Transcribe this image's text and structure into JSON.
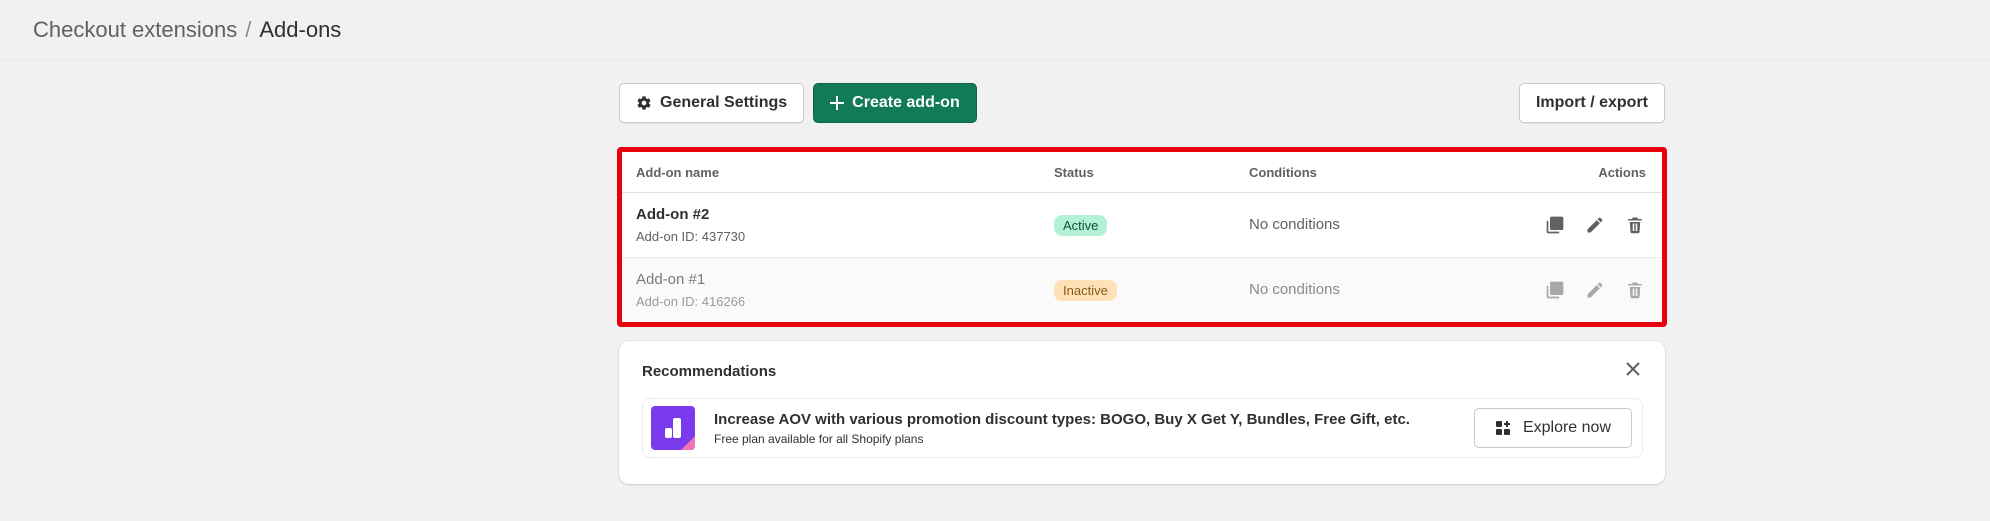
{
  "breadcrumb": {
    "parent": "Checkout extensions",
    "separator": "/",
    "current": "Add-ons"
  },
  "toolbar": {
    "general_settings_label": "General Settings",
    "create_label": "Create add-on",
    "import_export_label": "Import / export"
  },
  "table": {
    "headers": {
      "name": "Add-on name",
      "status": "Status",
      "conditions": "Conditions",
      "actions": "Actions"
    },
    "rows": [
      {
        "name": "Add-on #2",
        "id_text": "Add-on ID: 437730",
        "status": "Active",
        "conditions": "No conditions"
      },
      {
        "name": "Add-on #1",
        "id_text": "Add-on ID: 416266",
        "status": "Inactive",
        "conditions": "No conditions"
      }
    ]
  },
  "recommendations": {
    "title": "Recommendations",
    "headline": "Increase AOV with various promotion discount types: BOGO, Buy X Get Y, Bundles, Free Gift, etc.",
    "subtext": "Free plan available for all Shopify plans",
    "cta_label": "Explore now"
  },
  "icons": {
    "settings": "gear-icon",
    "create": "plus-icon",
    "duplicate": "duplicate-icon",
    "edit": "pencil-icon",
    "delete": "trash-icon",
    "close": "close-icon",
    "explore": "apps-icon"
  },
  "colors": {
    "primary": "#117a57",
    "highlight_border": "#e8000b",
    "active_badge_bg": "#b4f0d6",
    "inactive_badge_bg": "#ffe1b8",
    "app_logo": "#7c3aed"
  }
}
